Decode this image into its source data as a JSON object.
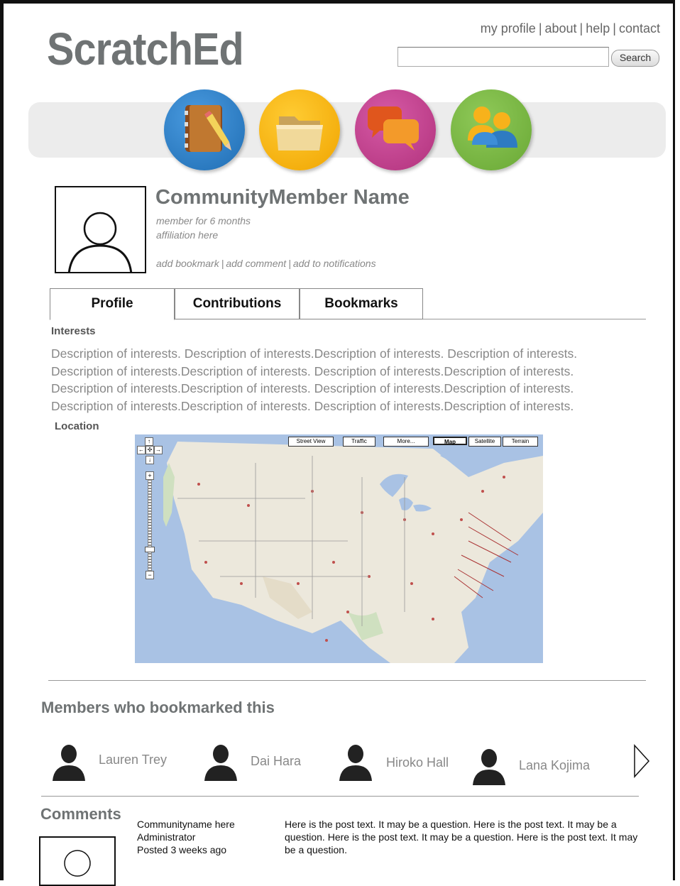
{
  "header": {
    "logo": "ScratchEd",
    "links": [
      "my profile",
      "about",
      "help",
      "contact"
    ],
    "search": {
      "value": "",
      "button_label": "Search"
    }
  },
  "nav_icons": [
    {
      "name": "notebook-pencil-icon",
      "color": "#2f7fc1"
    },
    {
      "name": "folder-icon",
      "color": "#f4b400"
    },
    {
      "name": "chat-bubbles-icon",
      "color": "#c2428d"
    },
    {
      "name": "people-icon",
      "color": "#7cb342"
    }
  ],
  "member": {
    "name": "CommunityMember Name",
    "tenure": "member for 6 months",
    "affiliation": "affiliation here",
    "actions": [
      "add bookmark",
      "add comment",
      "add to notifications"
    ]
  },
  "tabs": [
    "Profile",
    "Contributions",
    "Bookmarks"
  ],
  "interests": {
    "label": "Interests",
    "lines": [
      "Description of interests. Description of interests.Description of interests. Description of interests.",
      "Description of interests.Description of interests. Description of interests.Description of interests.",
      "Description of interests.Description of interests. Description of interests.Description of interests.",
      "Description of interests.Description of interests. Description of interests.Description of interests."
    ]
  },
  "location": {
    "label": "Location",
    "map_buttons": [
      "Street View",
      "Traffic",
      "More...",
      "Map",
      "Satellite",
      "Terrain"
    ],
    "selected_map_type": "Map"
  },
  "bookmarked_by": {
    "title": "Members who bookmarked this",
    "members": [
      "Lauren Trey",
      "Dai Hara",
      "Hiroko Hall",
      "Lana Kojima"
    ]
  },
  "comments": {
    "title": "Comments",
    "items": [
      {
        "author": "Communityname here",
        "role": "Administrator",
        "posted": "Posted 3 weeks ago",
        "text": "Here is the post text. It may be a question. Here is the post text. It may be a question. Here is the post text. It may be a question. Here is the post text. It may be a question."
      }
    ]
  }
}
